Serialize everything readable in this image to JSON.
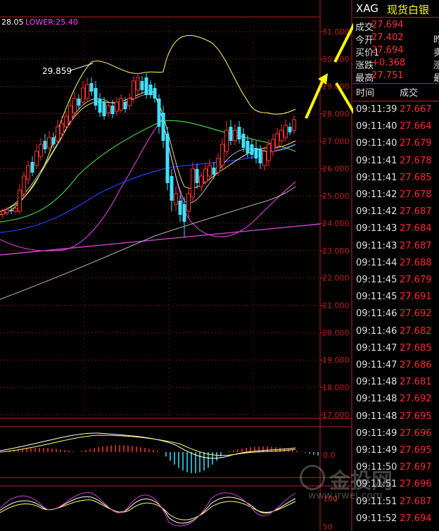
{
  "indicator": {
    "upper_label": "28.05",
    "lower_label": "LOWER:25.40"
  },
  "peak_label": "29.859",
  "price_axis": [
    "31.000",
    "30.000",
    "29.000",
    "28.000",
    "27.000",
    "26.000",
    "25.000",
    "24.000",
    "23.000",
    "22.000",
    "21.000",
    "20.000",
    "19.000",
    "18.000",
    "17.000"
  ],
  "macd_axis_label": "0.0",
  "kdj_axis": [
    "100",
    "50"
  ],
  "header": {
    "symbol": "XAG",
    "name": "现货白银"
  },
  "quote": [
    {
      "label": "成交",
      "value": "27.694",
      "extra": ""
    },
    {
      "label": "今开",
      "value": "27.402",
      "extra": "昨"
    },
    {
      "label": "买价1",
      "value": "27.694",
      "extra": "卖"
    },
    {
      "label": "涨跌",
      "value": "+0.368",
      "extra": "涨"
    },
    {
      "label": "最高",
      "value": "27.751",
      "extra": "最"
    }
  ],
  "ticks_header": {
    "time": "时间",
    "price": "成交"
  },
  "ticks": [
    {
      "time": "09:11:39",
      "price": "27.667"
    },
    {
      "time": "09:11:40",
      "price": "27.664"
    },
    {
      "time": "09:11:40",
      "price": "27.679"
    },
    {
      "time": "09:11:41",
      "price": "27.678"
    },
    {
      "time": "09:11:41",
      "price": "27.685"
    },
    {
      "time": "09:11:42",
      "price": "27.678"
    },
    {
      "time": "09:11:42",
      "price": "27.687"
    },
    {
      "time": "09:11:43",
      "price": "27.684"
    },
    {
      "time": "09:11:43",
      "price": "27.687"
    },
    {
      "time": "09:11:44",
      "price": "27.688"
    },
    {
      "time": "09:11:45",
      "price": "27.679"
    },
    {
      "time": "09:11:45",
      "price": "27.691"
    },
    {
      "time": "09:11:46",
      "price": "27.692"
    },
    {
      "time": "09:11:46",
      "price": "27.682"
    },
    {
      "time": "09:11:47",
      "price": "27.685"
    },
    {
      "time": "09:11:47",
      "price": "27.686"
    },
    {
      "time": "09:11:48",
      "price": "27.681"
    },
    {
      "time": "09:11:48",
      "price": "27.692"
    },
    {
      "time": "09:11:48",
      "price": "27.695"
    },
    {
      "time": "09:11:49",
      "price": "27.696"
    },
    {
      "time": "09:11:49",
      "price": "27.695"
    },
    {
      "time": "09:11:50",
      "price": "27.697"
    },
    {
      "time": "09:11:51",
      "price": "27.696"
    },
    {
      "time": "09:11:51",
      "price": "27.687"
    },
    {
      "time": "09:11:52",
      "price": "27.694"
    }
  ],
  "watermark": {
    "brand": "金投网",
    "url": "www.jrwei.com"
  },
  "colors": {
    "up": "#ff3030",
    "down": "#40e0ff",
    "axis_red": "#c02020",
    "ma_yellow": "#ffff60",
    "ma_green": "#40d040",
    "ma_blue": "#2040ff",
    "boll_magenta": "#d040d0"
  }
}
